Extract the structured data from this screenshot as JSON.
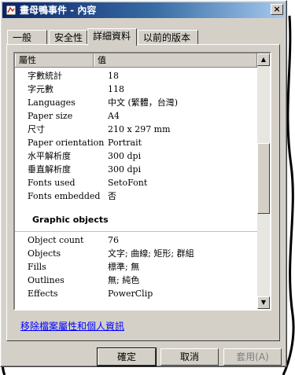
{
  "window": {
    "title": "畫母鴨事件 - 內容",
    "close_label": "×"
  },
  "tabs": [
    {
      "label": "一般"
    },
    {
      "label": "安全性"
    },
    {
      "label": "詳細資料"
    },
    {
      "label": "以前的版本"
    }
  ],
  "columns": {
    "property": "屬性",
    "value": "值"
  },
  "properties": [
    {
      "name": "字數統計",
      "value": "18"
    },
    {
      "name": "字元數",
      "value": "118"
    },
    {
      "name": "Languages",
      "value": "中文 (繁體，台灣)"
    },
    {
      "name": "Paper size",
      "value": "A4"
    },
    {
      "name": "尺寸",
      "value": "210 x 297 mm"
    },
    {
      "name": "Paper orientation",
      "value": "Portrait"
    },
    {
      "name": "水平解析度",
      "value": "300 dpi"
    },
    {
      "name": "垂直解析度",
      "value": "300 dpi"
    },
    {
      "name": "Fonts used",
      "value": "SetoFont"
    },
    {
      "name": "Fonts embedded",
      "value": "否"
    }
  ],
  "section_title": "Graphic objects",
  "graphic_properties": [
    {
      "name": "Object count",
      "value": "76"
    },
    {
      "name": "Objects",
      "value": "文字; 曲線; 矩形; 群組"
    },
    {
      "name": "Fills",
      "value": "標準; 無"
    },
    {
      "name": "Outlines",
      "value": "無; 純色"
    },
    {
      "name": "Effects",
      "value": "PowerClip"
    }
  ],
  "remove_link": "移除檔案屬性和個人資訊",
  "buttons": {
    "ok": "確定",
    "cancel": "取消",
    "apply": "套用(A)"
  },
  "icons": {
    "scroll_up": "scroll-up-arrow-icon",
    "scroll_down": "scroll-down-arrow-icon"
  }
}
